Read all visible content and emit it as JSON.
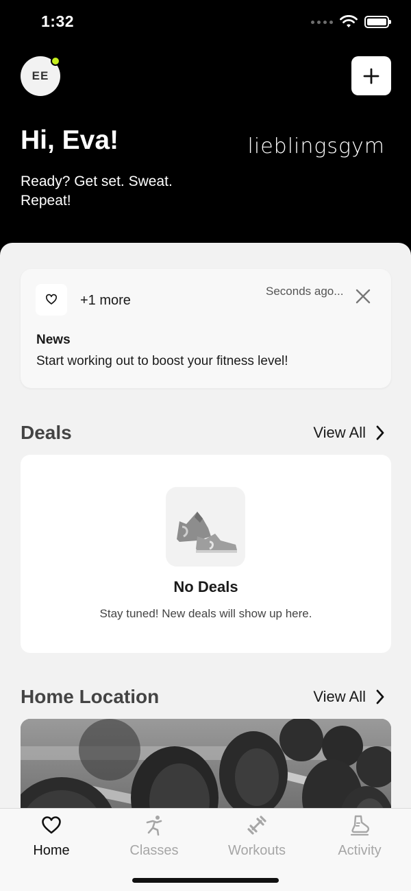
{
  "status_bar": {
    "time": "1:32"
  },
  "user": {
    "initials": "EE"
  },
  "header": {
    "greeting": "Hi, Eva!",
    "tagline": "Ready? Get set. Sweat. Repeat!",
    "brand": "lieblingsgym"
  },
  "news": {
    "more": "+1 more",
    "time": "Seconds ago...",
    "title": "News",
    "text": "Start working out to boost your fitness level!"
  },
  "deals": {
    "title": "Deals",
    "view_all": "View All",
    "empty_title": "No Deals",
    "empty_text": "Stay tuned! New deals will show up here."
  },
  "home_location": {
    "title": "Home Location",
    "view_all": "View All"
  },
  "tabs": [
    {
      "label": "Home",
      "icon": "heart-icon",
      "active": true
    },
    {
      "label": "Classes",
      "icon": "runner-icon",
      "active": false
    },
    {
      "label": "Workouts",
      "icon": "dumbbell-icon",
      "active": false
    },
    {
      "label": "Activity",
      "icon": "shoe-icon",
      "active": false
    }
  ],
  "colors": {
    "header_bg": "#000000",
    "sheet_bg": "#f2f2f2",
    "online_dot": "#c6ef1e",
    "tab_inactive": "#a6a6a6"
  }
}
